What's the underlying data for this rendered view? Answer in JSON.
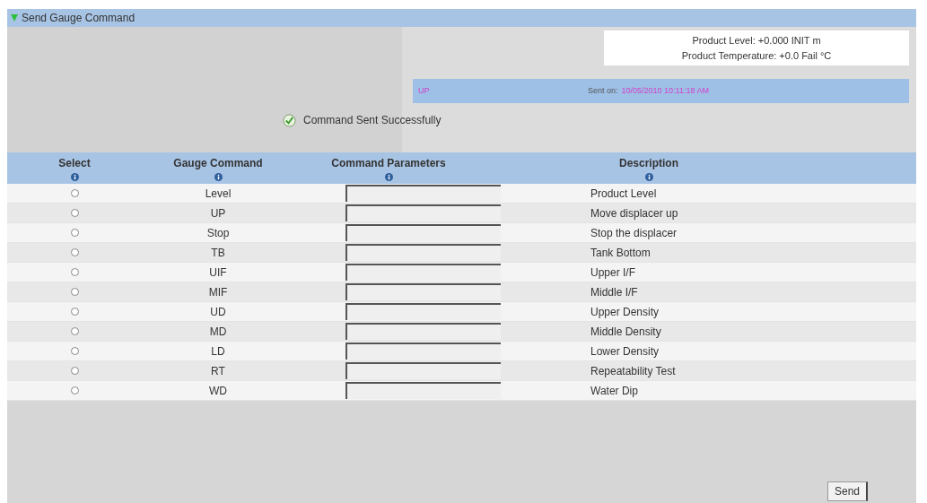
{
  "panel": {
    "title": "Send Gauge Command",
    "expanded": true
  },
  "readings": [
    "Product Level: +0.000  INIT  m",
    "Product Temperature: +0.0  Fail  °C"
  ],
  "last_command": {
    "command": "UP",
    "sent_label": "Sent on:",
    "sent_time": "10/05/2010 10:11:18 AM"
  },
  "status": {
    "message": "Command Sent Successfully",
    "success": true
  },
  "table": {
    "columns": [
      "Select",
      "Gauge Command",
      "Command Parameters",
      "Description"
    ],
    "rows": [
      {
        "command": "Level",
        "description": "Product Level",
        "selected": false
      },
      {
        "command": "UP",
        "description": "Move displacer up",
        "selected": false
      },
      {
        "command": "Stop",
        "description": "Stop the displacer",
        "selected": false
      },
      {
        "command": "TB",
        "description": "Tank Bottom",
        "selected": false
      },
      {
        "command": "UIF",
        "description": "Upper I/F",
        "selected": false
      },
      {
        "command": "MIF",
        "description": "Middle I/F",
        "selected": false
      },
      {
        "command": "UD",
        "description": "Upper Density",
        "selected": false
      },
      {
        "command": "MD",
        "description": "Middle Density",
        "selected": false
      },
      {
        "command": "LD",
        "description": "Lower Density",
        "selected": false
      },
      {
        "command": "RT",
        "description": "Repeatability Test",
        "selected": false
      },
      {
        "command": "WD",
        "description": "Water Dip",
        "selected": false
      }
    ]
  },
  "buttons": [
    "Send"
  ]
}
